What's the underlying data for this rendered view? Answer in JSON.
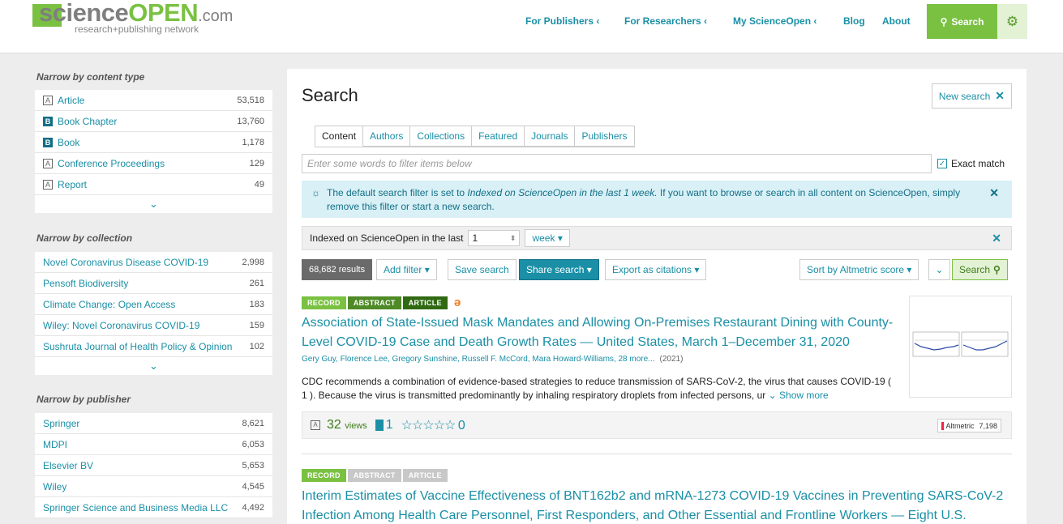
{
  "header": {
    "logo_science": "science",
    "logo_open": "OPEN",
    "logo_com": ".com",
    "logo_tagline": "research+publishing network",
    "nav": [
      "For Publishers ‹",
      "For Researchers ‹",
      "My ScienceOpen ‹",
      "Blog",
      "About"
    ],
    "search_label": "Search",
    "search_icon": "search-icon",
    "settings_icon": "gear-icon",
    "brand_color": "#7ac142",
    "link_color": "#1a8fa6"
  },
  "sidebar": {
    "content_type": {
      "heading": "Narrow by content type",
      "items": [
        {
          "label": "Article",
          "count": "53,518",
          "icon": "doc-icon"
        },
        {
          "label": "Book Chapter",
          "count": "13,760",
          "icon": "book-icon"
        },
        {
          "label": "Book",
          "count": "1,178",
          "icon": "book-icon"
        },
        {
          "label": "Conference Proceedings",
          "count": "129",
          "icon": "doc-icon"
        },
        {
          "label": "Report",
          "count": "49",
          "icon": "doc-icon"
        }
      ]
    },
    "collection": {
      "heading": "Narrow by collection",
      "items": [
        {
          "label": "Novel Coronavirus Disease COVID-19",
          "count": "2,998"
        },
        {
          "label": "Pensoft Biodiversity",
          "count": "261"
        },
        {
          "label": "Climate Change: Open Access",
          "count": "183"
        },
        {
          "label": "Wiley: Novel Coronavirus COVID-19",
          "count": "159"
        },
        {
          "label": "Sushruta Journal of Health Policy & Opinion",
          "count": "102"
        }
      ]
    },
    "publisher": {
      "heading": "Narrow by publisher",
      "items": [
        {
          "label": "Springer",
          "count": "8,621"
        },
        {
          "label": "MDPI",
          "count": "6,053"
        },
        {
          "label": "Elsevier BV",
          "count": "5,653"
        },
        {
          "label": "Wiley",
          "count": "4,545"
        },
        {
          "label": "Springer Science and Business Media LLC",
          "count": "4,492"
        }
      ]
    }
  },
  "main": {
    "title": "Search",
    "new_search": "New search",
    "tabs": [
      "Content",
      "Authors",
      "Collections",
      "Featured",
      "Journals",
      "Publishers"
    ],
    "filter_placeholder": "Enter some words to filter items below",
    "exact_match": "Exact match",
    "info_pre": "The default search filter is set to ",
    "info_em": "Indexed on ScienceOpen in the last 1 week.",
    "info_post": " If you want to browse or search in all content on ScienceOpen, simply remove this filter or start a new search.",
    "filter_label": "Indexed on ScienceOpen in the last",
    "filter_value": "1",
    "filter_unit": "week ▾",
    "results_count": "68,682 results",
    "add_filter": "Add filter ▾",
    "save_search": "Save search",
    "share_search": "Share search ▾",
    "export": "Export as citations ▾",
    "sort": "Sort by Altmetric score ▾",
    "search_btn": "Search"
  },
  "results": [
    {
      "badges": [
        "RECORD",
        "ABSTRACT",
        "ARTICLE"
      ],
      "title": "Association of State-Issued Mask Mandates and Allowing On-Premises Restaurant Dining with County-Level COVID-19 Case and Death Growth Rates — United States, March 1–December 31, 2020",
      "authors": "Gery Guy, Florence Lee, Gregory Sunshine, Russell F. McCord, Mara Howard-Williams, 28 more...",
      "year": "(2021)",
      "abstract": "CDC recommends a combination of evidence-based strategies to reduce transmission of SARS-CoV-2, the virus that causes COVID-19 ( 1 ). Because the virus is transmitted predominantly by inhaling respiratory droplets from infected persons, ur",
      "show_more": "Show more",
      "views": "32",
      "views_label": "views",
      "saves": "1",
      "rating": "0",
      "altmetric_label": "Altmetric",
      "altmetric_score": "7,198"
    },
    {
      "badges": [
        "RECORD",
        "ABSTRACT",
        "ARTICLE"
      ],
      "title": "Interim Estimates of Vaccine Effectiveness of BNT162b2 and mRNA-1273 COVID-19 Vaccines in Preventing SARS-CoV-2 Infection Among Health Care Personnel, First Responders, and Other Essential and Frontline Workers — Eight U.S."
    }
  ]
}
